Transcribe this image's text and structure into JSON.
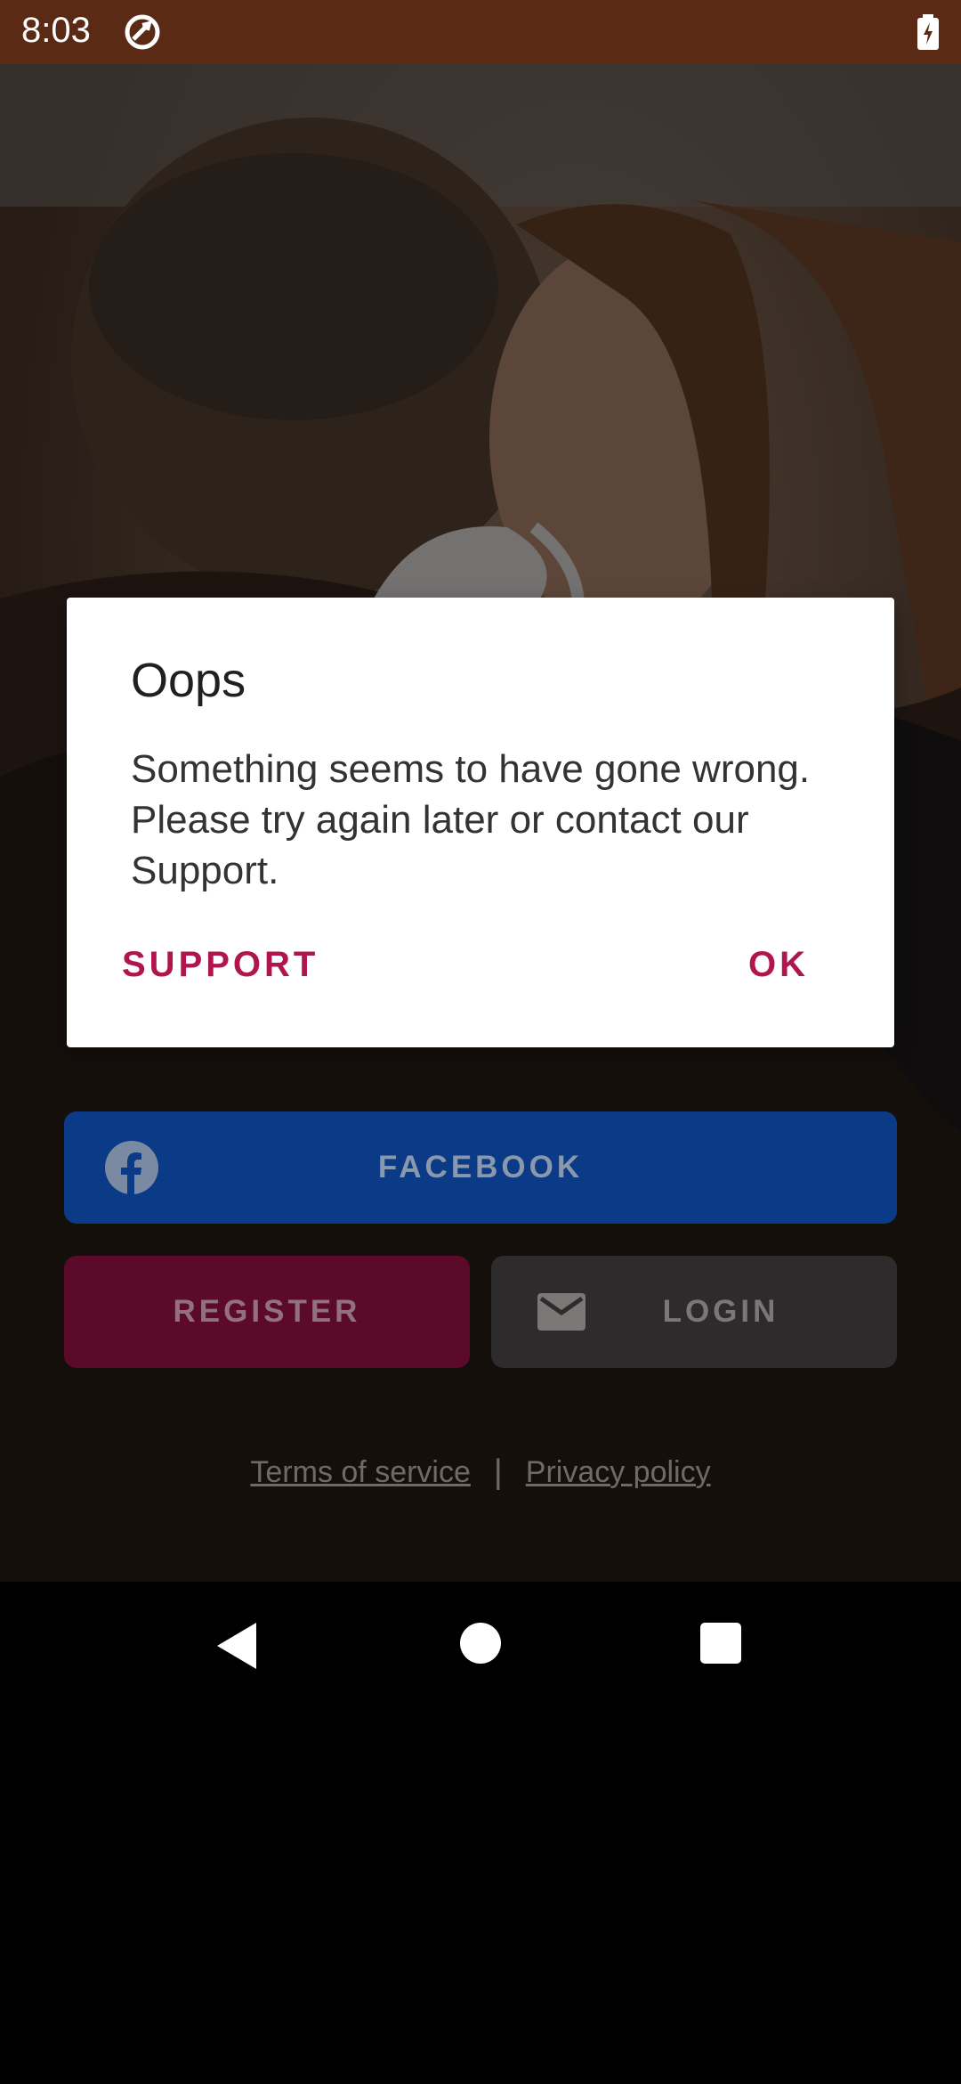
{
  "status_bar": {
    "time": "8:03",
    "app_icon": "sync-icon",
    "battery_icon": "battery-charging-icon"
  },
  "dialog": {
    "title": "Oops",
    "message": "Something seems to have gone wrong. Please try again later or contact our Support.",
    "support_label": "SUPPORT",
    "ok_label": "OK",
    "accent_color": "#b0164e"
  },
  "login": {
    "facebook_label": "FACEBOOK",
    "register_label": "REGISTER",
    "login_label": "LOGIN",
    "facebook_color": "#0b3a86",
    "register_color": "#5b0a2a"
  },
  "footer": {
    "terms": "Terms of service",
    "separator": "|",
    "privacy": "Privacy policy"
  },
  "nav": {
    "back_icon": "back-icon",
    "home_icon": "home-icon",
    "recents_icon": "recents-icon"
  }
}
